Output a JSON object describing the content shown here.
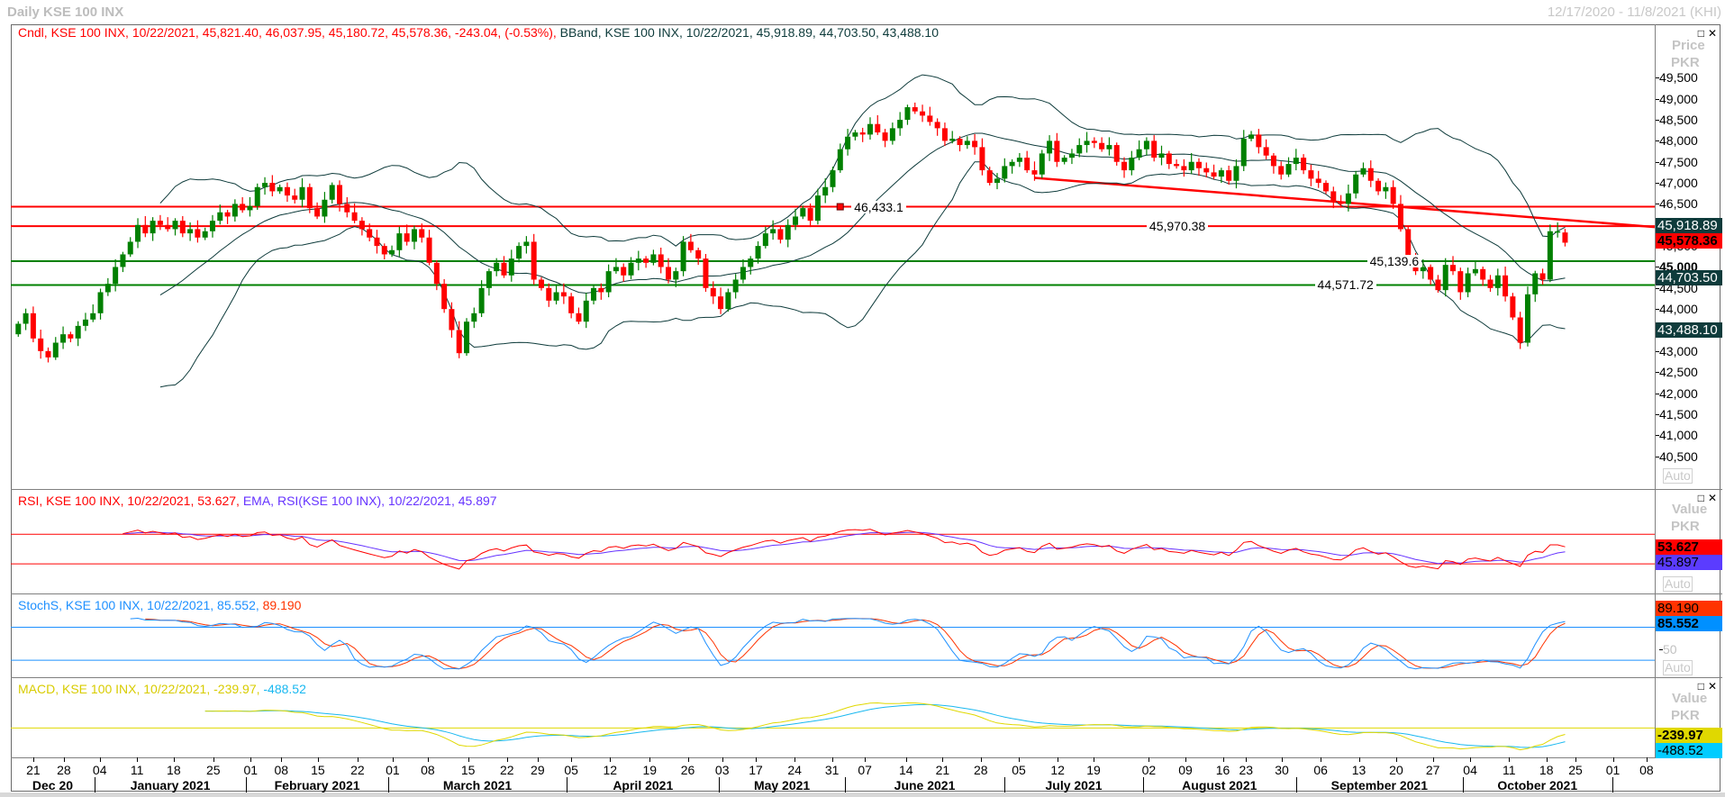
{
  "window": {
    "title": "Daily KSE 100 INX",
    "range": "12/17/2020 - 11/8/2021 (KHI)"
  },
  "legends": {
    "price_cndl": "Cndl, KSE 100 INX, 10/22/2021, 45,821.40, 46,037.95, 45,180.72, 45,578.36, -243.04, (-0.53%),",
    "price_bband": "BBand, KSE 100 INX, 10/22/2021, 45,918.89, 44,703.50, 43,488.10",
    "rsi": "RSI, KSE 100 INX, 10/22/2021, 53.627,",
    "rsi_ema": "EMA, RSI(KSE 100 INX), 10/22/2021, 45.897",
    "stoch_k": "StochS, KSE 100 INX, 10/22/2021, 85.552,",
    "stoch_d": "89.190",
    "macd": "MACD, KSE 100 INX, 10/22/2021, -239.97,",
    "macd_signal": "-488.52"
  },
  "axes": {
    "price_head": [
      "Price",
      "PKR"
    ],
    "value_head": [
      "Value",
      "PKR"
    ],
    "auto_label": "Auto",
    "stoch_tick": "50",
    "price_ticks": [
      "49,500",
      "49,000",
      "48,500",
      "48,000",
      "47,500",
      "47,000",
      "46,500",
      "46,000",
      "45,500",
      "45,000",
      "44,500",
      "44,000",
      "43,500",
      "43,000",
      "42,500",
      "42,000",
      "41,500",
      "41,000",
      "40,500"
    ],
    "price_tick_values": [
      49500,
      49000,
      48500,
      48000,
      47500,
      47000,
      46500,
      46000,
      45500,
      45000,
      44500,
      44000,
      43500,
      43000,
      42500,
      42000,
      41500,
      41000,
      40500
    ]
  },
  "badges": {
    "bb_upper": "45,918.89",
    "last_close": "45,578.36",
    "bb_mid": "44,703.50",
    "bb_lower": "43,488.10",
    "rsi": "53.627",
    "rsi_ema": "45.897",
    "stoch_d": "89.190",
    "stoch_k": "85.552",
    "macd": "-239.97",
    "macd_signal": "-488.52"
  },
  "colors": {
    "up": "#008000",
    "down": "#ff0000",
    "bband": "#0e3b3b",
    "rsi": "#ff0000",
    "rsi_ema": "#6633ff",
    "stoch_k": "#1e90ff",
    "stoch_d": "#ff3300",
    "macd": "#e0d800",
    "macd_signal": "#19b8f0",
    "support": "#008000",
    "resistance": "#ff0000"
  },
  "chart_data": {
    "type": "candlestick",
    "title": "Daily KSE 100 INX",
    "x_unit": "trading-day index",
    "xlim": [
      -1,
      219
    ],
    "price_ylim": [
      39720,
      50750
    ],
    "rsi_ylim": [
      -10,
      130
    ],
    "stoch_ylim": [
      -11,
      140
    ],
    "macd_ylim": [
      -1000,
      1700
    ],
    "last_open": 45821.4,
    "closes": [
      43650,
      43900,
      43300,
      43000,
      42850,
      43200,
      43400,
      43300,
      43600,
      43750,
      43900,
      44400,
      44600,
      45000,
      45300,
      45600,
      46000,
      45800,
      46100,
      46000,
      45900,
      46100,
      45800,
      45900,
      45700,
      45850,
      46100,
      46300,
      46200,
      46500,
      46350,
      46450,
      46900,
      47000,
      46800,
      46900,
      46700,
      46600,
      46900,
      46400,
      46200,
      46600,
      46950,
      46500,
      46300,
      46100,
      45900,
      45700,
      45500,
      45300,
      45400,
      45800,
      45600,
      45900,
      45700,
      45100,
      44600,
      44000,
      43500,
      42950,
      43700,
      43900,
      44500,
      44900,
      45100,
      44800,
      45200,
      45500,
      45600,
      44700,
      44500,
      44200,
      44400,
      44300,
      43900,
      43700,
      44200,
      44500,
      44400,
      44900,
      45000,
      44800,
      45100,
      45200,
      45100,
      45300,
      45000,
      44700,
      44900,
      45600,
      45400,
      45200,
      44500,
      44300,
      44000,
      44400,
      44700,
      45000,
      45200,
      45500,
      45800,
      45900,
      45650,
      46000,
      46200,
      46400,
      46100,
      46700,
      46900,
      47300,
      47800,
      48100,
      48200,
      48150,
      48400,
      48200,
      48000,
      48300,
      48500,
      48800,
      48700,
      48600,
      48450,
      48300,
      48000,
      48050,
      47900,
      48000,
      47850,
      47300,
      47000,
      47100,
      47400,
      47500,
      47600,
      47300,
      47200,
      47700,
      48000,
      47500,
      47600,
      47700,
      47900,
      48000,
      47950,
      47800,
      47900,
      47500,
      47300,
      47600,
      47800,
      48000,
      47600,
      47700,
      47450,
      47400,
      47300,
      47500,
      47350,
      47250,
      47150,
      47300,
      47050,
      47400,
      48050,
      48150,
      47850,
      47650,
      47400,
      47200,
      47450,
      47600,
      47300,
      47100,
      47000,
      46800,
      46550,
      46500,
      46750,
      47200,
      47350,
      47050,
      46800,
      46900,
      46500,
      45900,
      45200,
      44900,
      45000,
      44700,
      44450,
      45050,
      44900,
      44400,
      44850,
      44950,
      44700,
      44500,
      44800,
      44300,
      43800,
      43200,
      44350,
      44850,
      44700,
      45850,
      45850,
      45578.36
    ],
    "indicators": {
      "bollinger": {
        "period": 20,
        "stddev": 2,
        "last": [
          45918.89,
          44703.5,
          43488.1
        ]
      },
      "rsi": {
        "period": 14,
        "ema_period": 9,
        "levels": [
          70,
          30
        ],
        "last": [
          53.627,
          45.897
        ]
      },
      "stoch_slow": {
        "period": 14,
        "smooth": 3,
        "levels": [
          80,
          20
        ],
        "last": [
          85.552,
          89.19
        ]
      },
      "macd": {
        "fast": 12,
        "slow": 26,
        "signal": 9,
        "last": [
          -239.97,
          -488.52
        ]
      }
    },
    "horizontal_lines": [
      {
        "value": 46433.1,
        "label": "46,433.1",
        "kind": "resistance",
        "label_at": 111.5,
        "marker": true
      },
      {
        "value": 45970.38,
        "label": "45,970.38",
        "kind": "resistance",
        "label_at": 151
      },
      {
        "value": 45139.6,
        "label": "45,139.6",
        "kind": "support",
        "label_at": 180.5
      },
      {
        "value": 44571.72,
        "label": "44,571.72",
        "kind": "support",
        "label_at": 173.5
      }
    ],
    "trend_line": {
      "from": [
        136,
        47120
      ],
      "to": [
        219,
        45950
      ]
    },
    "x_ticks": [
      {
        "label": "21",
        "idx": 2.0
      },
      {
        "label": "28",
        "idx": 6.1
      },
      {
        "label": "04",
        "idx": 10.9
      },
      {
        "label": "11",
        "idx": 15.9
      },
      {
        "label": "18",
        "idx": 20.8
      },
      {
        "label": "25",
        "idx": 26.1
      },
      {
        "label": "01",
        "idx": 31.1
      },
      {
        "label": "08",
        "idx": 35.2
      },
      {
        "label": "15",
        "idx": 40.1
      },
      {
        "label": "22",
        "idx": 45.4
      },
      {
        "label": "01",
        "idx": 50.1
      },
      {
        "label": "08",
        "idx": 54.8
      },
      {
        "label": "15",
        "idx": 60.2
      },
      {
        "label": "22",
        "idx": 65.4
      },
      {
        "label": "29",
        "idx": 69.5
      },
      {
        "label": "05",
        "idx": 74.0
      },
      {
        "label": "12",
        "idx": 79.2
      },
      {
        "label": "19",
        "idx": 84.5
      },
      {
        "label": "26",
        "idx": 89.6
      },
      {
        "label": "03",
        "idx": 94.2
      },
      {
        "label": "17",
        "idx": 98.7
      },
      {
        "label": "24",
        "idx": 103.9
      },
      {
        "label": "31",
        "idx": 108.9
      },
      {
        "label": "07",
        "idx": 113.3
      },
      {
        "label": "14",
        "idx": 118.8
      },
      {
        "label": "21",
        "idx": 123.7
      },
      {
        "label": "28",
        "idx": 128.8
      },
      {
        "label": "05",
        "idx": 133.9
      },
      {
        "label": "12",
        "idx": 139.1
      },
      {
        "label": "19",
        "idx": 143.9
      },
      {
        "label": "02",
        "idx": 151.3
      },
      {
        "label": "09",
        "idx": 156.2
      },
      {
        "label": "16",
        "idx": 161.2
      },
      {
        "label": "23",
        "idx": 164.3
      },
      {
        "label": "30",
        "idx": 169.1
      },
      {
        "label": "06",
        "idx": 174.3
      },
      {
        "label": "13",
        "idx": 179.4
      },
      {
        "label": "20",
        "idx": 184.4
      },
      {
        "label": "27",
        "idx": 189.3
      },
      {
        "label": "04",
        "idx": 194.3
      },
      {
        "label": "11",
        "idx": 199.5
      },
      {
        "label": "18",
        "idx": 204.5
      },
      {
        "label": "25",
        "idx": 208.4
      },
      {
        "label": "01",
        "idx": 213.4
      },
      {
        "label": "08",
        "idx": 217.9
      }
    ],
    "months": [
      {
        "label": "Dec 20",
        "start": -1,
        "end": 10.2
      },
      {
        "label": "January 2021",
        "start": 10.2,
        "end": 30.5
      },
      {
        "label": "February 2021",
        "start": 30.5,
        "end": 49.5
      },
      {
        "label": "March 2021",
        "start": 49.5,
        "end": 73.4
      },
      {
        "label": "April 2021",
        "start": 73.4,
        "end": 93.8
      },
      {
        "label": "May 2021",
        "start": 93.8,
        "end": 110.6
      },
      {
        "label": "June 2021",
        "start": 110.6,
        "end": 132
      },
      {
        "label": "July 2021",
        "start": 132,
        "end": 150.5
      },
      {
        "label": "August 2021",
        "start": 150.5,
        "end": 171
      },
      {
        "label": "September 2021",
        "start": 171,
        "end": 193.3
      },
      {
        "label": "October 2021",
        "start": 193.3,
        "end": 213.3
      }
    ]
  }
}
